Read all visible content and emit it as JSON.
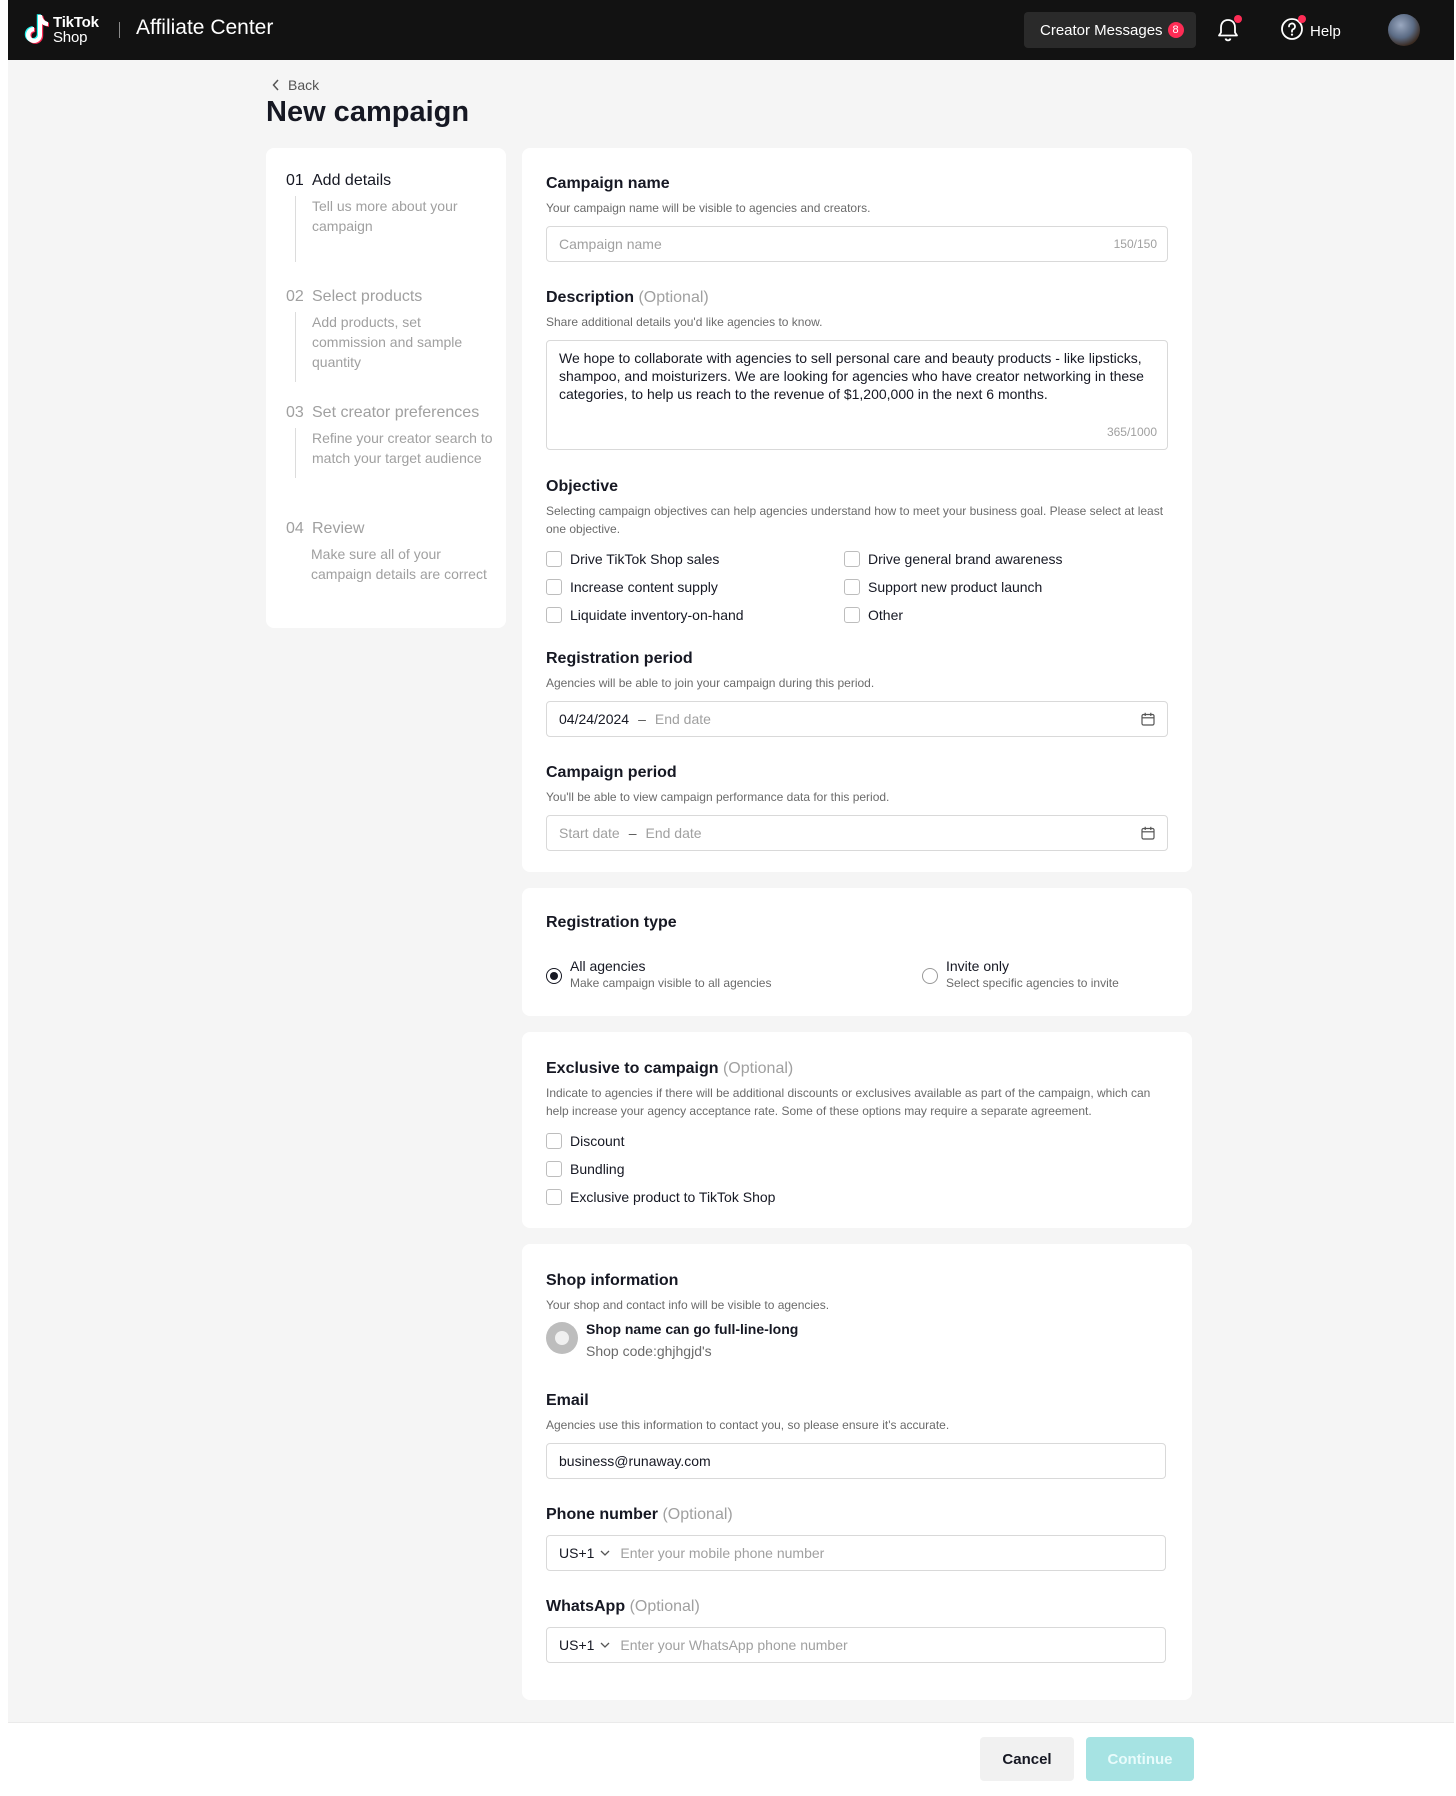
{
  "topbar": {
    "logo_line1": "TikTok",
    "logo_line2": "Shop",
    "app_title": "Affiliate Center",
    "messages_label": "Creator Messages",
    "messages_count": "8",
    "help_label": "Help"
  },
  "header": {
    "back_label": "Back",
    "title": "New campaign"
  },
  "steps": [
    {
      "num": "01",
      "title": "Add details",
      "desc": "Tell us more about your campaign"
    },
    {
      "num": "02",
      "title": "Select products",
      "desc": "Add products, set commission and sample quantity"
    },
    {
      "num": "03",
      "title": "Set creator preferences",
      "desc": "Refine your creator search to match your target audience"
    },
    {
      "num": "04",
      "title": "Review",
      "desc": "Make sure all of your campaign details are correct"
    }
  ],
  "details": {
    "campaign_name": {
      "label": "Campaign name",
      "help": "Your campaign name will be visible to agencies and creators.",
      "placeholder": "Campaign name",
      "counter": "150/150"
    },
    "description": {
      "label": "Description",
      "optional": "(Optional)",
      "help": "Share additional details you'd like agencies to know.",
      "value": "We hope to collaborate with agencies to sell personal care and beauty products - like lipsticks, shampoo, and moisturizers. We are looking for agencies who have creator networking in these categories, to help us reach to the revenue of $1,200,000 in the next 6 months.",
      "counter": "365/1000"
    },
    "objective": {
      "label": "Objective",
      "help": "Selecting campaign objectives can help agencies understand how to meet your business goal. Please select at least one objective.",
      "options": [
        "Drive TikTok Shop sales",
        "Drive general brand awareness",
        "Increase content supply",
        "Support new product launch",
        "Liquidate inventory-on-hand",
        "Other"
      ]
    },
    "registration_period": {
      "label": "Registration period",
      "help": "Agencies will be able to join your campaign during this period.",
      "start_value": "04/24/2024",
      "separator": "–",
      "end_placeholder": "End date"
    },
    "campaign_period": {
      "label": "Campaign period",
      "help": "You'll be able to view campaign performance data for this period.",
      "start_placeholder": "Start date",
      "separator": "–",
      "end_placeholder": "End date"
    }
  },
  "registration_type": {
    "label": "Registration type",
    "options": [
      {
        "label": "All agencies",
        "sub": "Make campaign visible to all agencies",
        "selected": true
      },
      {
        "label": "Invite only",
        "sub": "Select specific agencies to invite",
        "selected": false
      }
    ]
  },
  "exclusive": {
    "label": "Exclusive to campaign",
    "optional": "(Optional)",
    "help": "Indicate to agencies if there will be additional discounts or exclusives available as part of the campaign, which can help increase your agency acceptance rate. Some of these options may require a separate agreement.",
    "options": [
      "Discount",
      "Bundling",
      "Exclusive product to TikTok Shop"
    ]
  },
  "shop": {
    "label": "Shop information",
    "help": "Your shop and contact info will be visible to agencies.",
    "name": "Shop name can go full-line-long",
    "code": "Shop code:ghjhgjd's",
    "email": {
      "label": "Email",
      "help": "Agencies use this information to contact you, so please ensure it's accurate.",
      "value": "business@runaway.com"
    },
    "phone": {
      "label": "Phone number",
      "optional": "(Optional)",
      "country_code": "US+1",
      "placeholder": "Enter your mobile phone number"
    },
    "whatsapp": {
      "label": "WhatsApp",
      "optional": "(Optional)",
      "country_code": "US+1",
      "placeholder": "Enter your WhatsApp phone number"
    }
  },
  "footer": {
    "cancel_label": "Cancel",
    "continue_label": "Continue"
  },
  "colors": {
    "topbar_bg": "#121212",
    "badge": "#fe2c55",
    "continue_disabled": "#a6e3e3",
    "page_bg": "#f5f5f5"
  }
}
